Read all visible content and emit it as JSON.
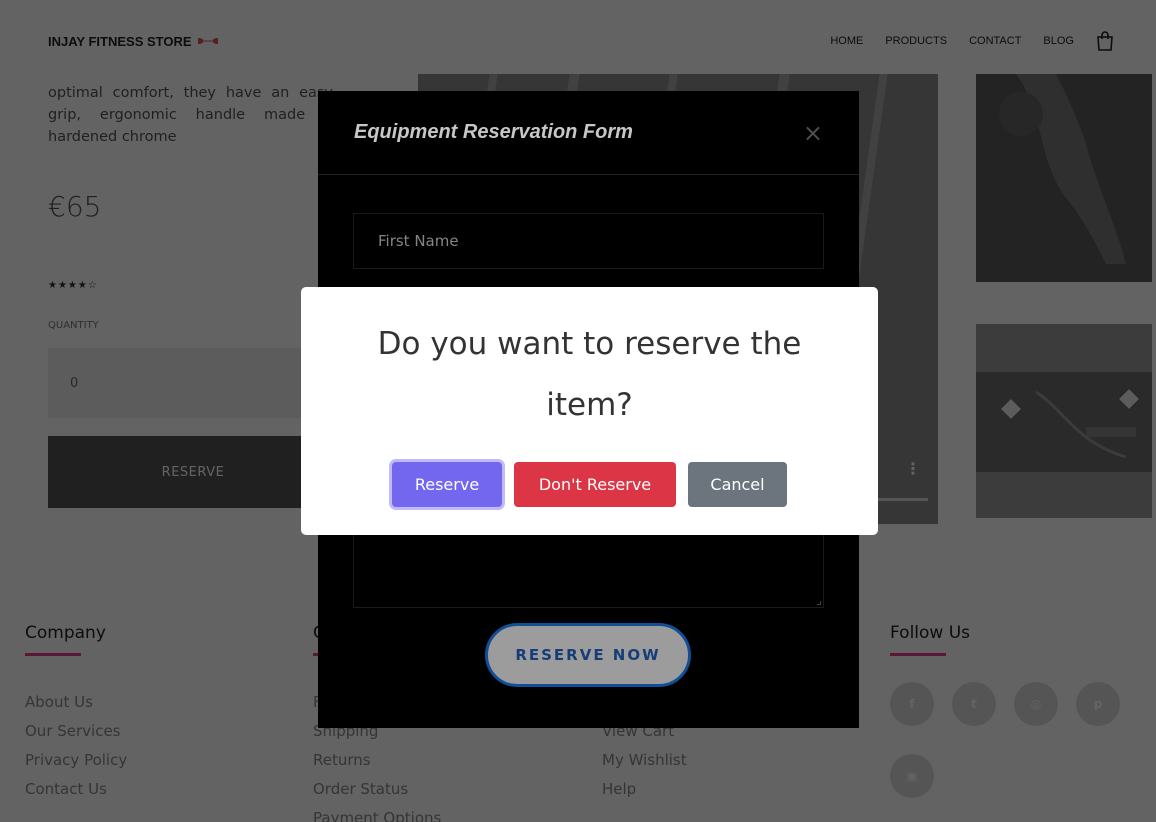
{
  "navbar": {
    "brand": "INJAY FITNESS STORE",
    "links": [
      "HOME",
      "PRODUCTS",
      "CONTACT",
      "BLOG"
    ]
  },
  "product": {
    "description": "optimal comfort, they have an easy-grip, ergonomic handle made of hardened chrome",
    "price": "€65",
    "rating": "★★★★☆",
    "quantity_label": "QUANTITY",
    "quantity_value": "0",
    "reserve_label": "RESERVE"
  },
  "footer": {
    "columns": [
      {
        "title": "Company",
        "items": [
          "About Us",
          "Our Services",
          "Privacy Policy",
          "Contact Us"
        ]
      },
      {
        "title": "C",
        "items": [
          "F",
          "Shipping",
          "Returns",
          "Order Status",
          "Payment Options"
        ]
      },
      {
        "title": "",
        "items": [
          "",
          "View Cart",
          "My Wishlist",
          "Help"
        ]
      },
      {
        "title": "Follow Us",
        "items": []
      }
    ],
    "socials": [
      "facebook-icon",
      "twitter-icon",
      "instagram-icon",
      "pinterest-icon",
      "youtube-icon"
    ]
  },
  "form_modal": {
    "title": "Equipment Reservation Form",
    "close": "×",
    "first_name_placeholder": "First Name",
    "submit_label": "RESERVE NOW"
  },
  "confirm_dialog": {
    "question": "Do you want to reserve the item?",
    "reserve": "Reserve",
    "dont_reserve": "Don't Reserve",
    "cancel": "Cancel"
  },
  "colors": {
    "accent": "#7367f0",
    "danger": "#dc3545",
    "secondary": "#6c757d",
    "footer_underline": "#e83e8c"
  }
}
